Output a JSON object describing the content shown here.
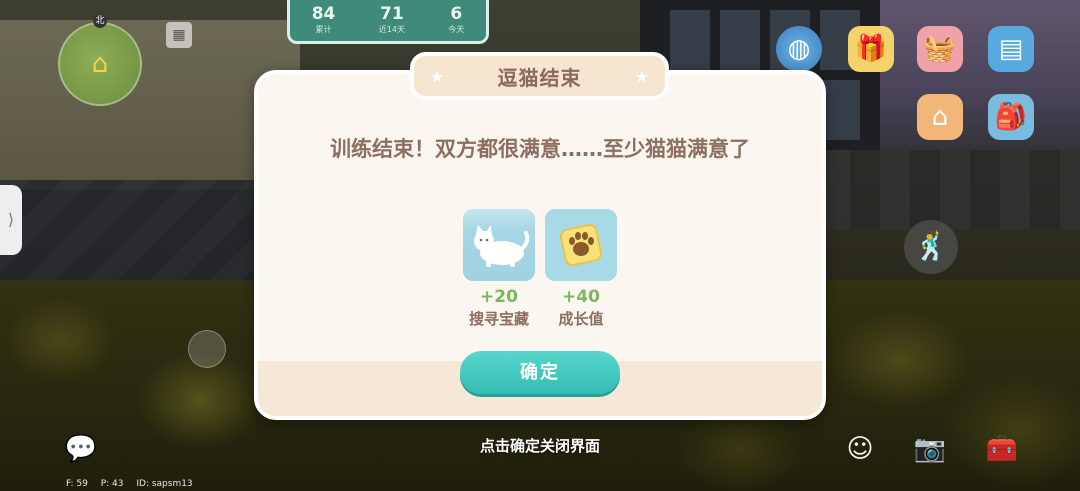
{
  "stats": [
    {
      "value": "84",
      "label": "累计"
    },
    {
      "value": "71",
      "label": "近14天"
    },
    {
      "value": "6",
      "label": "今天"
    }
  ],
  "hud": {
    "compass": "北",
    "side_tab_arrow": "⟩",
    "close_hint": "点击确定关闭界面"
  },
  "icons": {
    "minimap": "home-marker-icon",
    "calendar": "calendar-icon",
    "planet": "planet-icon",
    "gift": "gift-box-icon",
    "shop": "shop-basket-icon",
    "tablet": "tablet-icon",
    "house": "house-icon",
    "backpack": "backpack-icon",
    "action": "dance-action-icon",
    "chat": "chat-icon",
    "emote": "emote-icon",
    "camera": "camera-icon",
    "tools": "toolbox-icon"
  },
  "dialog": {
    "title": "逗猫结束",
    "message": "训练结束！双方都很满意……至少猫猫满意了",
    "rewards": [
      {
        "amount": "+20",
        "label": "搜寻宝藏",
        "icon": "white-cat-icon"
      },
      {
        "amount": "+40",
        "label": "成长值",
        "icon": "paw-card-icon"
      }
    ],
    "confirm_label": "确定"
  },
  "debug": {
    "fps": "F: 59",
    "ping": "P: 43",
    "id": "ID: sapsm13"
  },
  "colors": {
    "accent_teal": "#3fc7bd",
    "title_brown": "#8a6a58",
    "reward_green": "#79b85e",
    "stats_panel": "#3f8a78"
  }
}
